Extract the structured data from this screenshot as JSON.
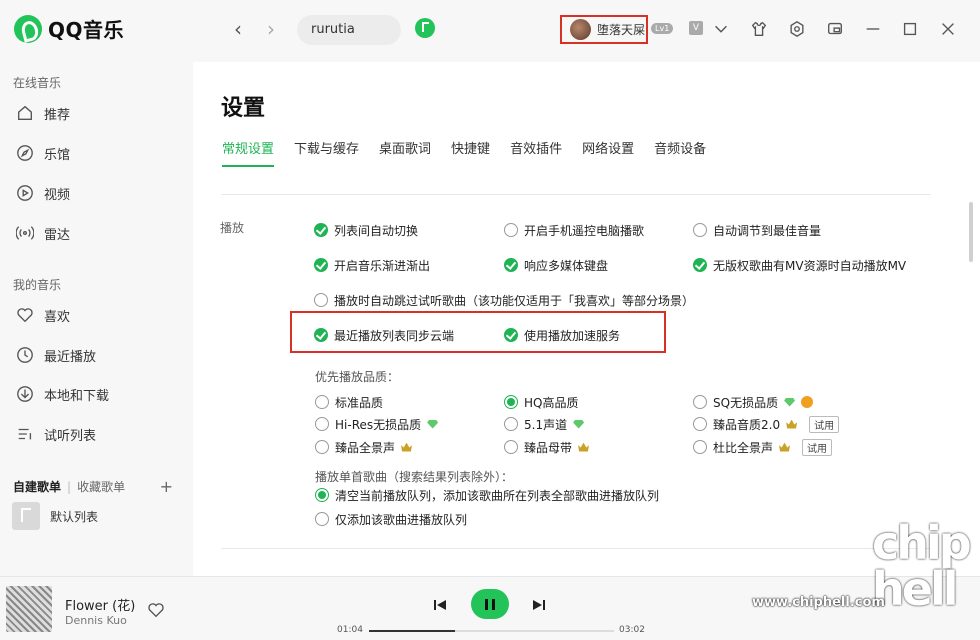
{
  "app": {
    "name": "QQ音乐"
  },
  "sidebar": {
    "online_title": "在线音乐",
    "online_items": [
      {
        "label": "推荐",
        "icon": "home-icon"
      },
      {
        "label": "乐馆",
        "icon": "compass-icon"
      },
      {
        "label": "视频",
        "icon": "video-icon"
      },
      {
        "label": "雷达",
        "icon": "radar-icon"
      }
    ],
    "my_title": "我的音乐",
    "my_items": [
      {
        "label": "喜欢",
        "icon": "heart-icon"
      },
      {
        "label": "最近播放",
        "icon": "clock-icon"
      },
      {
        "label": "本地和下载",
        "icon": "download-icon"
      },
      {
        "label": "试听列表",
        "icon": "list-icon"
      }
    ],
    "playlist_tab_created": "自建歌单",
    "playlist_tab_collected": "收藏歌单",
    "playlist_add": "+",
    "default_list": "默认列表"
  },
  "topbar": {
    "search_value": "rurutia",
    "username": "堕落天屎",
    "level": "Lv1",
    "vip_badge": "V"
  },
  "settings": {
    "title": "设置",
    "tabs": [
      "常规设置",
      "下载与缓存",
      "桌面歌词",
      "快捷键",
      "音效插件",
      "网络设置",
      "音频设备"
    ],
    "active_tab": 0,
    "section_play": "播放",
    "play_options": [
      {
        "label": "列表间自动切换",
        "checked": true
      },
      {
        "label": "开启手机遥控电脑播歌",
        "checked": false
      },
      {
        "label": "自动调节到最佳音量",
        "checked": false
      },
      {
        "label": "开启音乐渐进渐出",
        "checked": true
      },
      {
        "label": "响应多媒体键盘",
        "checked": true
      },
      {
        "label": "无版权歌曲有MV资源时自动播放MV",
        "checked": true
      },
      {
        "label": "播放时自动跳过试听歌曲（该功能仅适用于「我喜欢」等部分场景）",
        "checked": false
      },
      {
        "label": "最近播放列表同步云端",
        "checked": true
      },
      {
        "label": "使用播放加速服务",
        "checked": true
      }
    ],
    "quality_title": "优先播放品质：",
    "quality_options": [
      {
        "label": "标准品质",
        "selected": false,
        "badge": "",
        "trial": false
      },
      {
        "label": "HQ高品质",
        "selected": true,
        "badge": "",
        "trial": false
      },
      {
        "label": "SQ无损品质",
        "selected": false,
        "badge": "diamond+coin",
        "trial": false
      },
      {
        "label": "Hi-Res无损品质",
        "selected": false,
        "badge": "diamond",
        "trial": false
      },
      {
        "label": "5.1声道",
        "selected": false,
        "badge": "diamond",
        "trial": false
      },
      {
        "label": "臻品音质2.0",
        "selected": false,
        "badge": "crown",
        "trial": true
      },
      {
        "label": "臻品全景声",
        "selected": false,
        "badge": "crown",
        "trial": false
      },
      {
        "label": "臻品母带",
        "selected": false,
        "badge": "crown",
        "trial": false
      },
      {
        "label": "杜比全景声",
        "selected": false,
        "badge": "crown",
        "trial": true
      }
    ],
    "trial_label": "试用",
    "first_song_title": "播放单首歌曲（搜索结果列表除外）：",
    "first_song_options": [
      {
        "label": "清空当前播放队列，添加该歌曲所在列表全部歌曲进播放队列",
        "selected": true
      },
      {
        "label": "仅添加该歌曲进播放队列",
        "selected": false
      }
    ]
  },
  "player": {
    "song_title": "Flower (花)",
    "artist": "Dennis Kuo",
    "current_time": "01:04",
    "total_time": "03:02",
    "progress": 0.35
  },
  "watermark": {
    "text": "www.chiphell.com",
    "logo": "chip hell"
  },
  "colors": {
    "accent": "#1fb453",
    "highlight_border": "#d93025"
  }
}
